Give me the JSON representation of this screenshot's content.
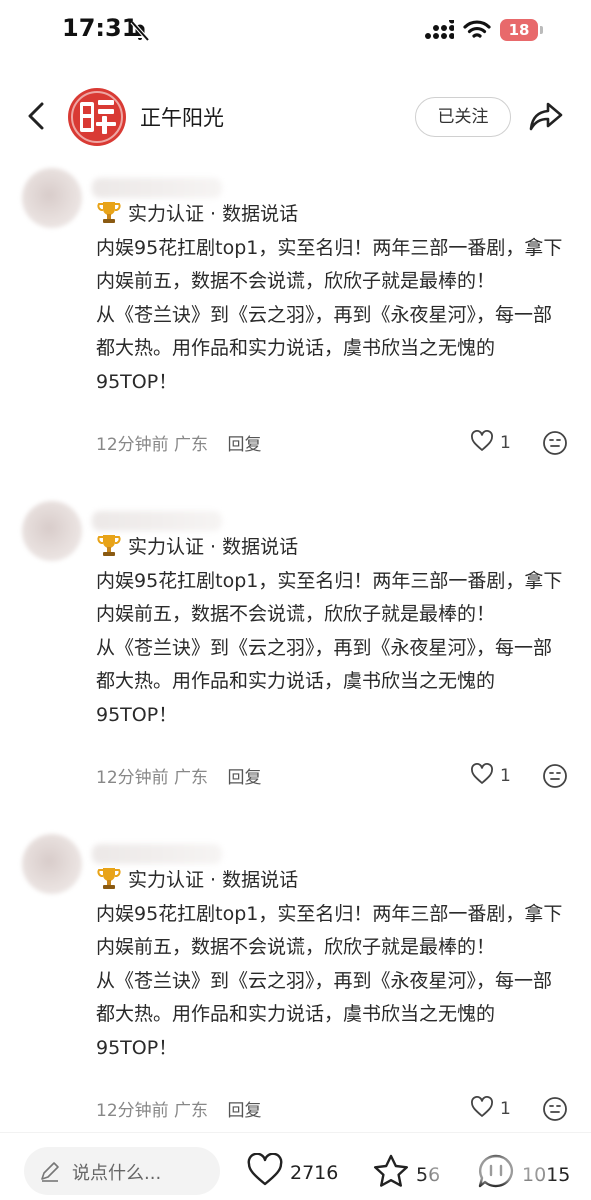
{
  "status_bar": {
    "time": "17:31",
    "battery": "18",
    "icons": [
      "bell-off-icon",
      "signal-icon",
      "wifi-icon",
      "battery-icon"
    ],
    "battery_color": "#e8696b"
  },
  "header": {
    "username": "正午阳光",
    "follow_label": "已关注",
    "back_icon": "chevron-left-icon",
    "share_icon": "share-arrow-icon",
    "brand_color": "#d93a34"
  },
  "comments": [
    {
      "badge_icon": "trophy-icon",
      "line1": "实力认证 · 数据说话",
      "line2": "内娱95花扛剧top1，实至名归！两年三部一番剧，拿下内娱前五，数据不会说谎，欣欣子就是最棒的！",
      "line3": "从《苍兰诀》到《云之羽》，再到《永夜星河》，每一部都大热。用作品和实力说话，虞书欣当之无愧的95TOP！",
      "time": "12分钟前",
      "location": "广东",
      "reply_label": "回复",
      "likes": "1"
    },
    {
      "badge_icon": "trophy-icon",
      "line1": "实力认证 · 数据说话",
      "line2": "内娱95花扛剧top1，实至名归！两年三部一番剧，拿下内娱前五，数据不会说谎，欣欣子就是最棒的！",
      "line3": "从《苍兰诀》到《云之羽》，再到《永夜星河》，每一部都大热。用作品和实力说话，虞书欣当之无愧的95TOP！",
      "time": "12分钟前",
      "location": "广东",
      "reply_label": "回复",
      "likes": "1"
    },
    {
      "badge_icon": "trophy-icon",
      "line1": "实力认证 · 数据说话",
      "line2": "内娱95花扛剧top1，实至名归！两年三部一番剧，拿下内娱前五，数据不会说谎，欣欣子就是最棒的！",
      "line3": "从《苍兰诀》到《云之羽》，再到《永夜星河》，每一部都大热。用作品和实力说话，虞书欣当之无愧的95TOP！",
      "time": "12分钟前",
      "location": "广东",
      "reply_label": "回复",
      "likes": "1"
    }
  ],
  "bottom_bar": {
    "input_placeholder": "说点什么...",
    "like_count": "2716",
    "favorite_count": "56",
    "comment_count": "1015"
  }
}
